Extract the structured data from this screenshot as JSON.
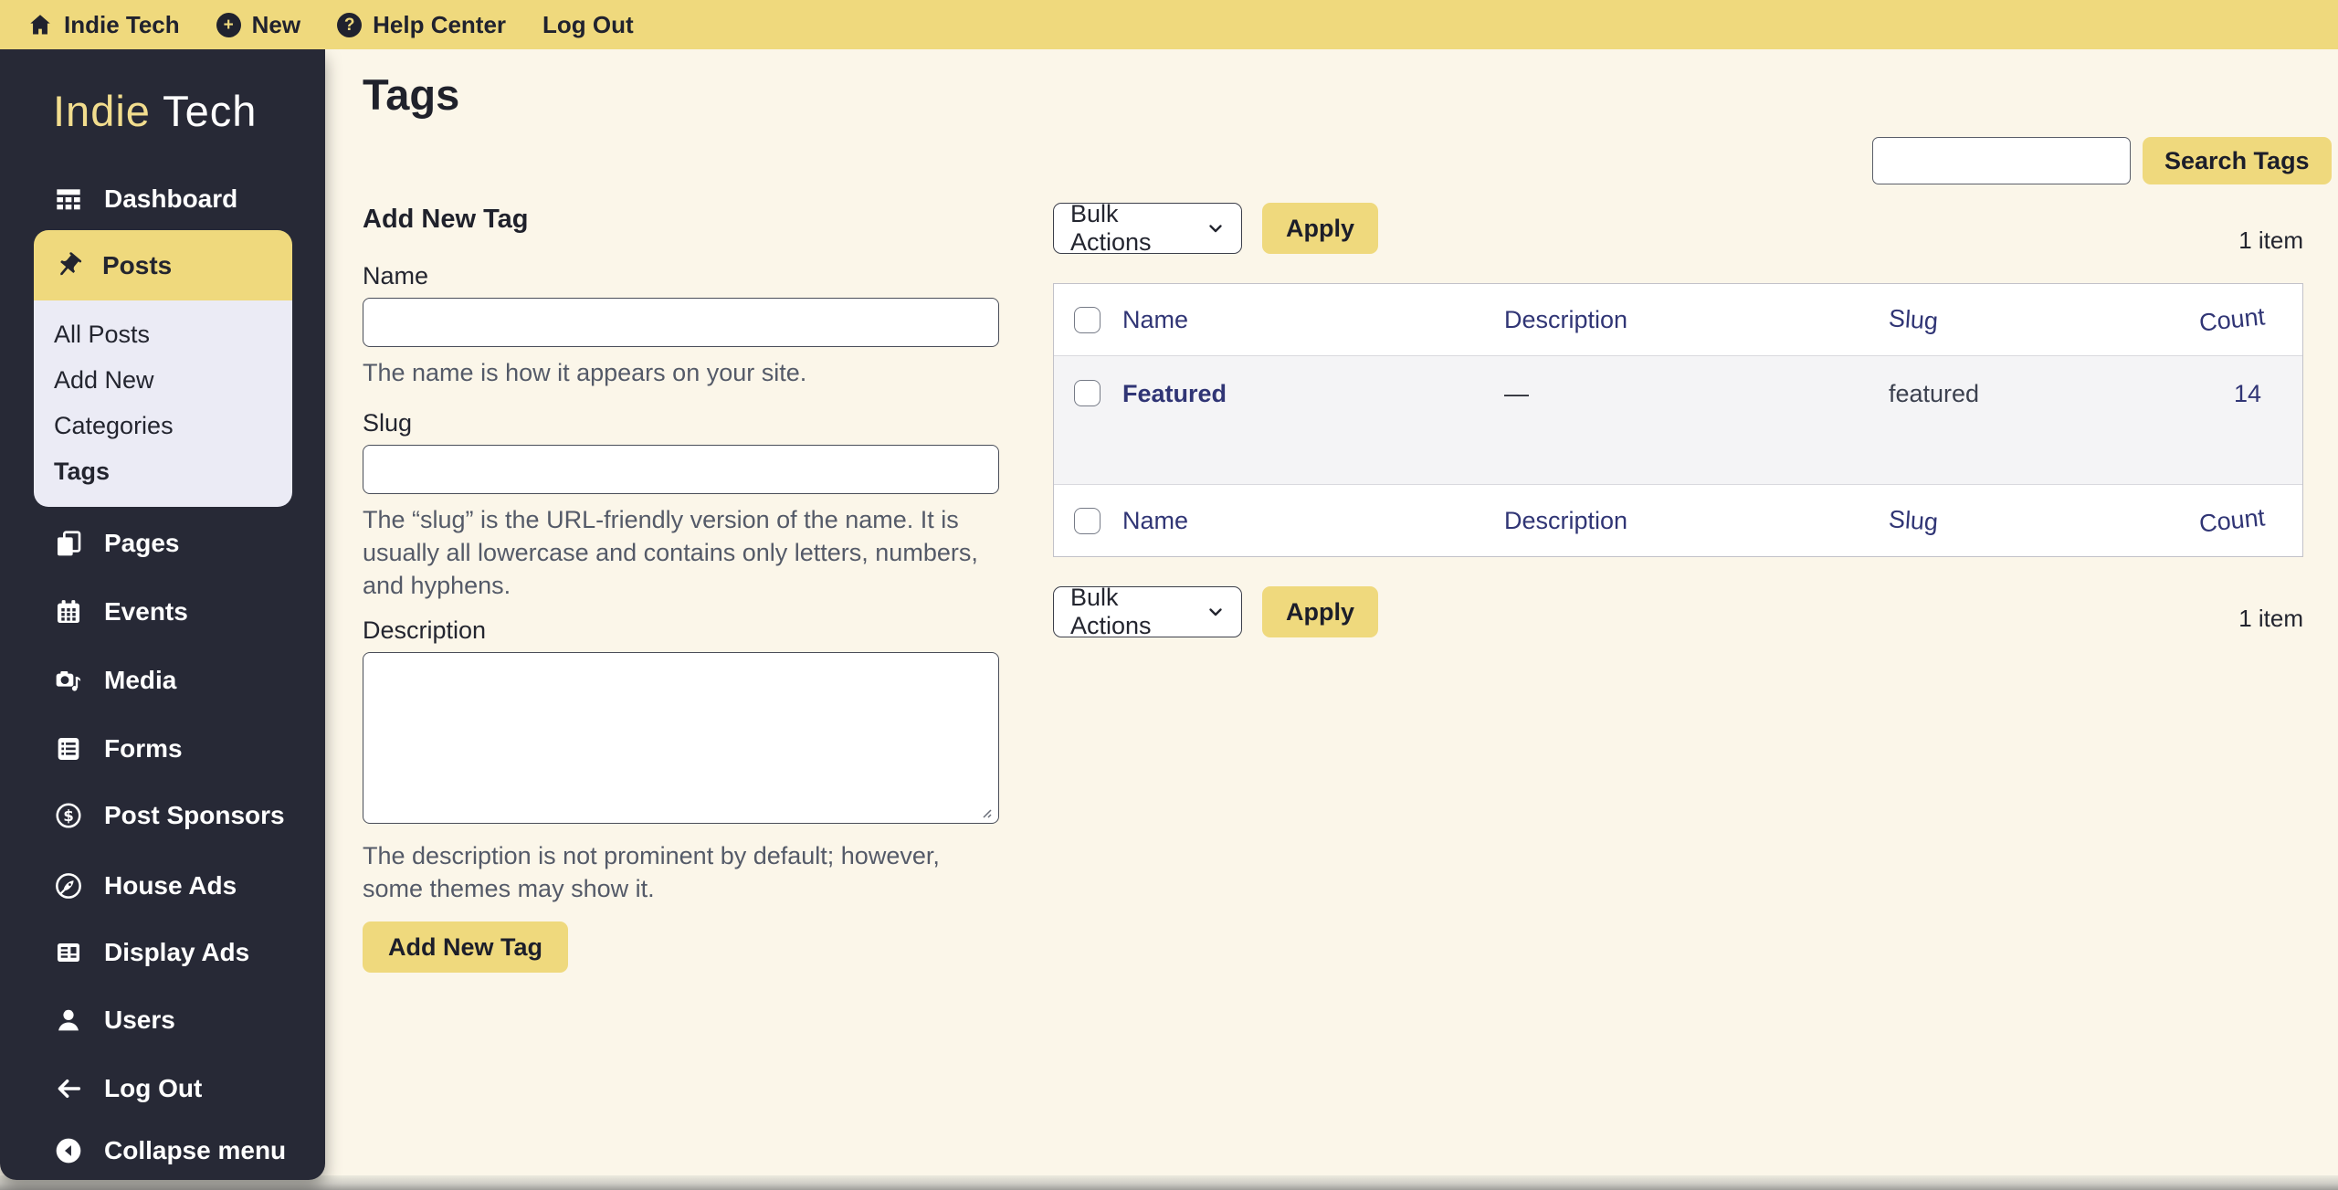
{
  "topbar": {
    "site_name": "Indie Tech",
    "new_label": "New",
    "help_label": "Help Center",
    "logout_label": "Log Out"
  },
  "sidebar": {
    "logo_part1": "Indie",
    "logo_part2": "Tech",
    "dashboard_label": "Dashboard",
    "posts": {
      "label": "Posts",
      "submenu": [
        {
          "label": "All Posts"
        },
        {
          "label": "Add New"
        },
        {
          "label": "Categories"
        },
        {
          "label": "Tags"
        }
      ]
    },
    "items": [
      {
        "label": "Pages"
      },
      {
        "label": "Events"
      },
      {
        "label": "Media"
      },
      {
        "label": "Forms"
      },
      {
        "label": "Post Sponsors"
      },
      {
        "label": "House Ads"
      },
      {
        "label": "Display Ads"
      },
      {
        "label": "Users"
      },
      {
        "label": "Log Out"
      },
      {
        "label": "Collapse menu"
      }
    ]
  },
  "page": {
    "title": "Tags",
    "search": {
      "value": "",
      "button_label": "Search Tags"
    },
    "form": {
      "heading": "Add New Tag",
      "name_label": "Name",
      "name_help": "The name is how it appears on your site.",
      "slug_label": "Slug",
      "slug_help": "The “slug” is the URL-friendly version of the name. It is usually all lowercase and contains only letters, numbers, and hyphens.",
      "description_label": "Description",
      "description_value": "",
      "description_help": "The description is not prominent by default; however, some themes may show it.",
      "submit_label": "Add New Tag"
    },
    "list": {
      "bulk_actions_label": "Bulk Actions",
      "apply_label": "Apply",
      "item_count": "1 item",
      "columns": [
        "Name",
        "Description",
        "Slug",
        "Count"
      ],
      "rows": [
        {
          "name": "Featured",
          "description": "—",
          "slug": "featured",
          "count": "14"
        }
      ]
    }
  },
  "colors": {
    "accent_yellow": "#efd97d",
    "sidebar_dark": "#272936",
    "link_navy": "#303575",
    "background_cream": "#fbf6e9"
  }
}
